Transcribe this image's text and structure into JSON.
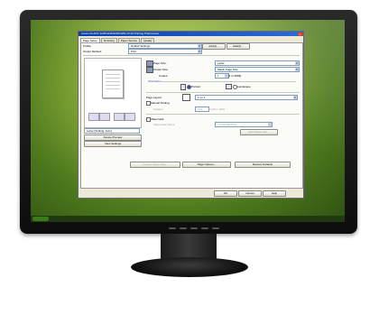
{
  "dialog": {
    "title": "Canon iR-ADV 4225/4235/4245/4251 PCL6 Printing Preferences",
    "close": "x",
    "tabs": [
      "Page Setup",
      "Finishing",
      "Paper Source",
      "Quality"
    ]
  },
  "profile": {
    "label": "Profile:",
    "value": "Default Settings",
    "add": "Add(1)...",
    "edit": "Edit(2)..."
  },
  "output": {
    "label": "Output Method:",
    "value": "Print"
  },
  "preview": {
    "caption": "Letter [Scaling: Auto]",
    "device_preview": "Device Preview",
    "view_settings": "View Settings"
  },
  "page_size": {
    "label": "Page Size:",
    "value": "Letter"
  },
  "output_size": {
    "label": "Output Size:",
    "value": "Match Page Size"
  },
  "copies": {
    "label": "Copies:",
    "value": "1",
    "range": "[1 to 9999]"
  },
  "orientation": {
    "label": "Orientation",
    "portrait": "Portrait",
    "landscape": "Landscape"
  },
  "page_layout": {
    "label": "Page Layout:",
    "value": "1 on 1"
  },
  "manual_scaling": {
    "label": "Manual Scaling",
    "scaling_label": "Scaling:",
    "value": "100",
    "range": "% [25 to 200]"
  },
  "watermark": {
    "label": "Watermark",
    "name_label": "Watermark Name:",
    "value": "CONFIDENTIAL",
    "edit": "Edit Watermark..."
  },
  "buttons": {
    "custom_paper": "Custom Paper Size...",
    "page_options": "Page Options...",
    "restore": "Restore Defaults",
    "ok": "OK",
    "cancel": "Cancel",
    "help": "Help"
  },
  "colors": {
    "title_bar": "#0a3fa8",
    "desktop": "#6f9a2c"
  }
}
